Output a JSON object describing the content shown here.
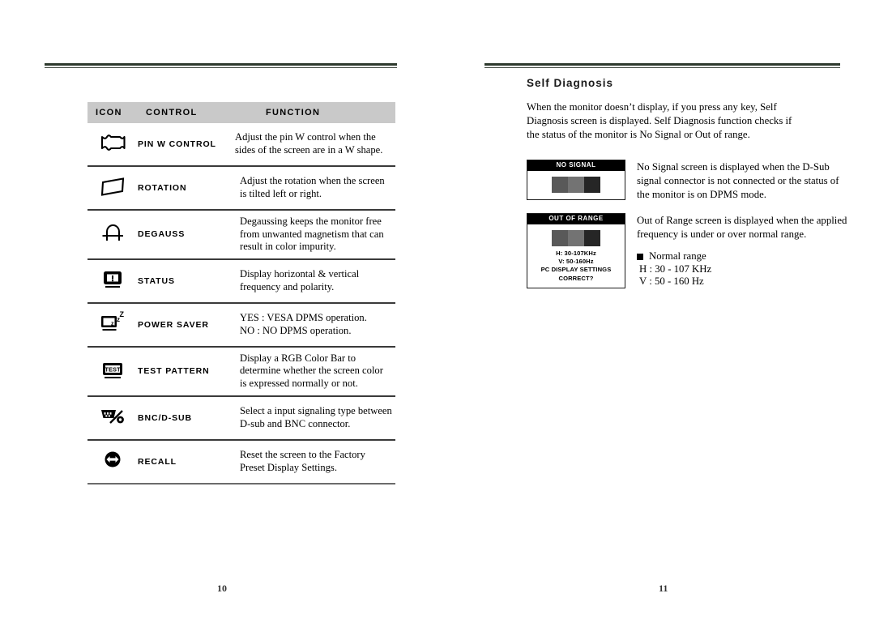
{
  "left_page": {
    "page_number": "10",
    "table": {
      "headers": {
        "icon": "ICON",
        "control": "CONTROL",
        "function": "FUNCTION"
      },
      "rows": [
        {
          "icon": "pin-w-control-icon",
          "control": "PIN W CONTROL",
          "function": "Adjust the pin W control when the sides of the screen are in a W shape."
        },
        {
          "icon": "rotation-icon",
          "control": "ROTATION",
          "function": "Adjust the rotation when the screen is tilted left or right."
        },
        {
          "icon": "degauss-icon",
          "control": "DEGAUSS",
          "function": "Degaussing keeps the monitor free from unwanted magnetism that can result in color impurity."
        },
        {
          "icon": "status-icon",
          "control": "STATUS",
          "function": "Display horizontal & vertical frequency and polarity."
        },
        {
          "icon": "power-saver-icon",
          "control": "POWER SAVER",
          "function": "YES : VESA DPMS operation.\nNO : NO DPMS operation."
        },
        {
          "icon": "test-pattern-icon",
          "control": "TEST PATTERN",
          "function": "Display a RGB Color Bar to determine whether the screen color is expressed normally or not."
        },
        {
          "icon": "bnc-dsub-icon",
          "control": "BNC/D-SUB",
          "function": "Select a input signaling type between D-sub and BNC connector."
        },
        {
          "icon": "recall-icon",
          "control": "RECALL",
          "function": "Reset the screen to the Factory Preset Display Settings."
        }
      ]
    }
  },
  "right_page": {
    "page_number": "11",
    "title": "Self Diagnosis",
    "intro": "When the monitor doesn’t  display, if you press any key, Self Diagnosis screen is displayed.  Self Diagnosis function checks if the status of the monitor is No Signal or Out of range.",
    "no_signal": {
      "osd_title": "NO SIGNAL",
      "description": "No Signal screen is displayed when the D-Sub signal connector is not connected or the status of the monitor is on DPMS mode."
    },
    "out_of_range": {
      "osd_title": "OUT OF RANGE",
      "osd_h_line": "H: 30-107KHz",
      "osd_v_line": "V: 50-160Hz",
      "osd_prompt_line1": "PC DISPLAY SETTINGS",
      "osd_prompt_line2": "CORRECT?",
      "description": "Out of Range screen is displayed when the applied frequency is under or over normal range."
    },
    "normal_range": {
      "heading": "Normal range",
      "h_line": "H : 30 - 107 KHz",
      "v_line": "V : 50 - 160 Hz"
    }
  },
  "colors": {
    "rule": "#2e3a2e",
    "header_bg": "#c9c9c9",
    "osd_bar_1": "#595959",
    "osd_bar_2": "#737373",
    "osd_bar_3": "#262626"
  }
}
